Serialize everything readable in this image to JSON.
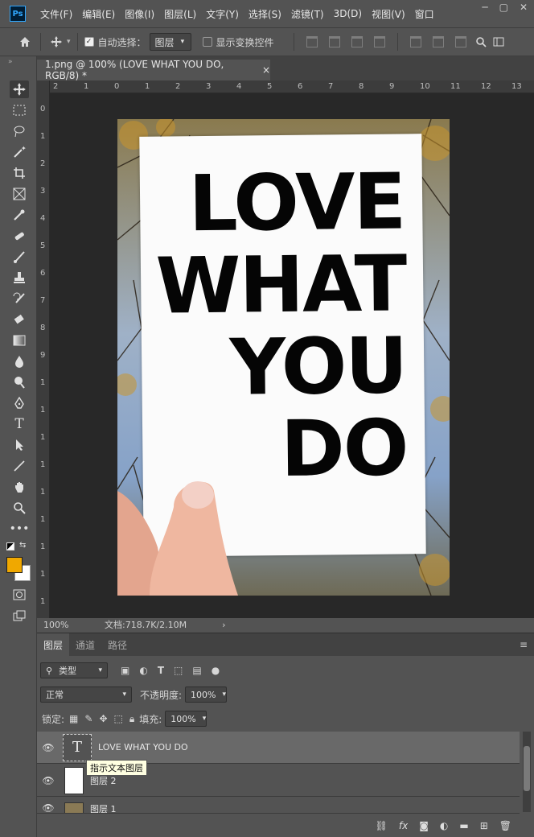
{
  "app": {
    "logo": "Ps"
  },
  "menu": [
    "文件(F)",
    "编辑(E)",
    "图像(I)",
    "图层(L)",
    "文字(Y)",
    "选择(S)",
    "滤镜(T)",
    "3D(D)",
    "视图(V)",
    "窗口"
  ],
  "options": {
    "auto_select_label": "自动选择：",
    "auto_select_value": "图层",
    "show_transform_label": "显示变换控件"
  },
  "document": {
    "tab_title": "1.png @ 100% (LOVE WHAT YOU DO, RGB/8) *",
    "close_glyph": "×",
    "poster_lines": [
      "LOVE",
      "WHAT",
      "YOU",
      "DO"
    ]
  },
  "ruler": {
    "h_labels": [
      "2",
      "1",
      "0",
      "1",
      "2",
      "3",
      "4",
      "5",
      "6",
      "7",
      "8",
      "9",
      "10",
      "11",
      "12",
      "13"
    ],
    "v_labels": [
      "0",
      "1",
      "2",
      "3",
      "4",
      "5",
      "6",
      "7",
      "8",
      "9",
      "1",
      "1",
      "1",
      "1",
      "1",
      "1",
      "1",
      "1",
      "1"
    ]
  },
  "status": {
    "zoom": "100%",
    "doc_info": "文档:718.7K/2.10M",
    "arrow": "›"
  },
  "layers_panel": {
    "tabs": [
      "图层",
      "通道",
      "路径"
    ],
    "filter_label": "类型",
    "blend_mode": "正常",
    "opacity_label": "不透明度:",
    "opacity_value": "100%",
    "lock_label": "锁定:",
    "fill_label": "填充:",
    "fill_value": "100%",
    "layers": [
      {
        "name": "LOVE WHAT YOU DO",
        "type_glyph": "T"
      },
      {
        "name": "图层 2"
      },
      {
        "name": "图层 1"
      }
    ],
    "tooltip": "指示文本图层"
  },
  "colors": {
    "foreground": "#f0a800",
    "background": "#ffffff"
  }
}
